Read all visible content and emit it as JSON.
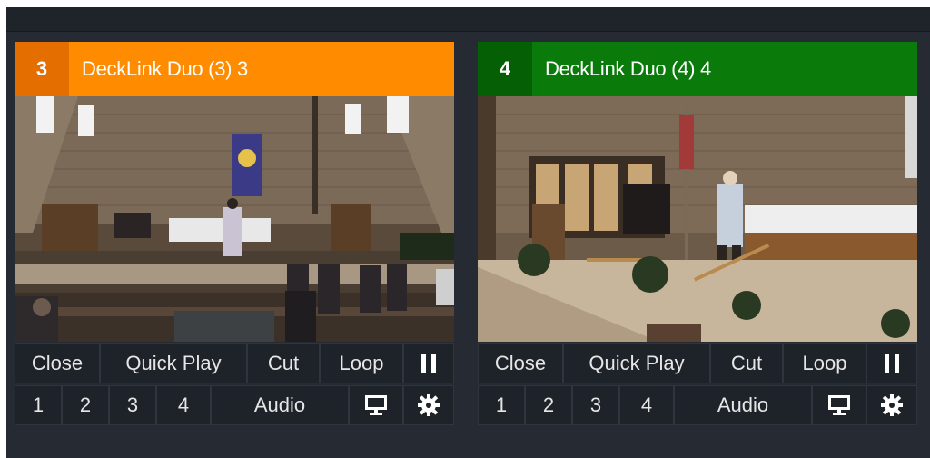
{
  "panels": [
    {
      "number": "3",
      "title": "DeckLink Duo (3) 3",
      "accent": "#ff8c00",
      "accent_dark": "#e46e00",
      "controls": {
        "close": "Close",
        "quick_play": "Quick Play",
        "cut": "Cut",
        "loop": "Loop",
        "pause_icon": "pause-icon",
        "overlay_1": "1",
        "overlay_2": "2",
        "overlay_3": "3",
        "overlay_4": "4",
        "audio": "Audio",
        "monitor_icon": "monitor-icon",
        "settings_icon": "gear-icon"
      }
    },
    {
      "number": "4",
      "title": "DeckLink Duo (4) 4",
      "accent": "#0a7a0a",
      "accent_dark": "#056005",
      "controls": {
        "close": "Close",
        "quick_play": "Quick Play",
        "cut": "Cut",
        "loop": "Loop",
        "pause_icon": "pause-icon",
        "overlay_1": "1",
        "overlay_2": "2",
        "overlay_3": "3",
        "overlay_4": "4",
        "audio": "Audio",
        "monitor_icon": "monitor-icon",
        "settings_icon": "gear-icon"
      }
    }
  ]
}
